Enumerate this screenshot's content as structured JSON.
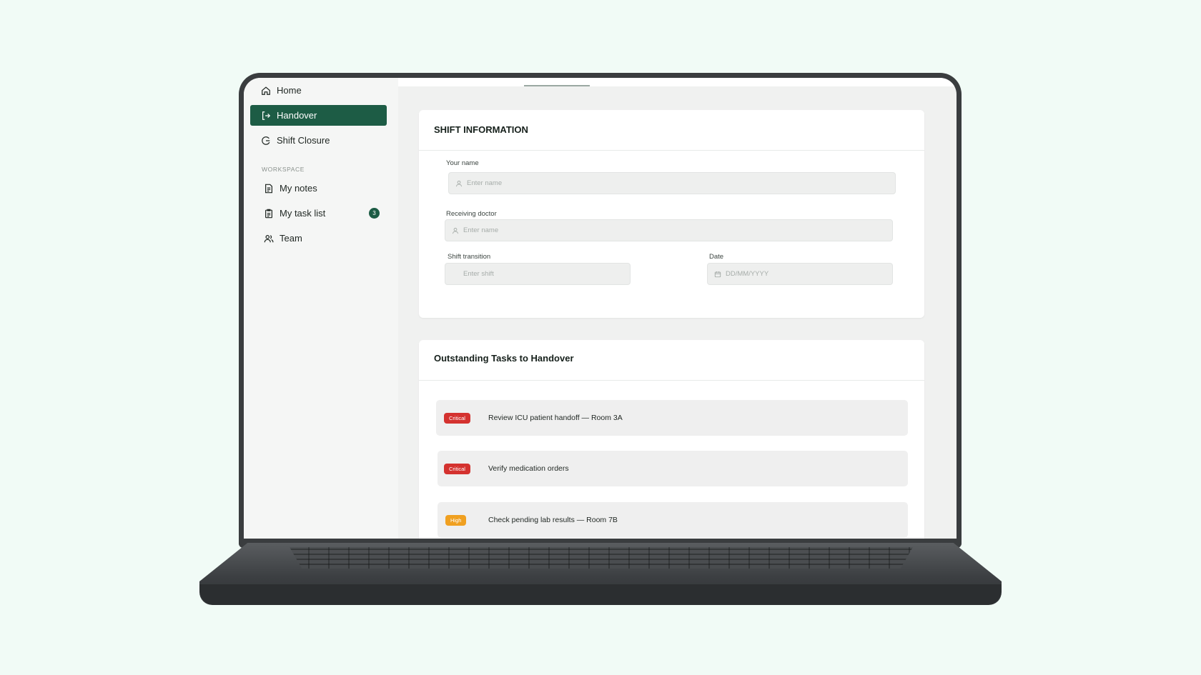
{
  "sidebar": {
    "items": [
      {
        "label": "Home",
        "icon": "home-icon",
        "active": false
      },
      {
        "label": "Handover",
        "icon": "handover-icon",
        "active": true
      },
      {
        "label": "Shift Closure",
        "icon": "shift-closure-icon",
        "active": false
      }
    ],
    "workspace_label": "WORKSPACE",
    "workspace_items": [
      {
        "label": "My notes",
        "icon": "notes-icon"
      },
      {
        "label": "My task list",
        "icon": "clipboard-icon",
        "badge": "3"
      },
      {
        "label": "Team",
        "icon": "team-icon"
      }
    ]
  },
  "shift_info": {
    "title": "SHIFT INFORMATION",
    "your_name_label": "Your name",
    "your_name_placeholder": "Enter name",
    "receiving_doctor_label": "Receiving doctor",
    "receiving_doctor_placeholder": "Enter name",
    "shift_transition_label": "Shift transition",
    "shift_transition_placeholder": "Enter shift",
    "date_label": "Date",
    "date_placeholder": "DD/MM/YYYY"
  },
  "tasks": {
    "title": "Outstanding Tasks to Handover",
    "items": [
      {
        "priority": "Critical",
        "text": "Review ICU patient handoff — Room 3A"
      },
      {
        "priority": "Critical",
        "text": "Verify medication orders"
      },
      {
        "priority": "High",
        "text": "Check pending lab results — Room 7B"
      }
    ]
  },
  "colors": {
    "accent": "#1d5c45",
    "critical": "#d4322f",
    "high": "#f0a020",
    "background": "#f1fbf6"
  }
}
